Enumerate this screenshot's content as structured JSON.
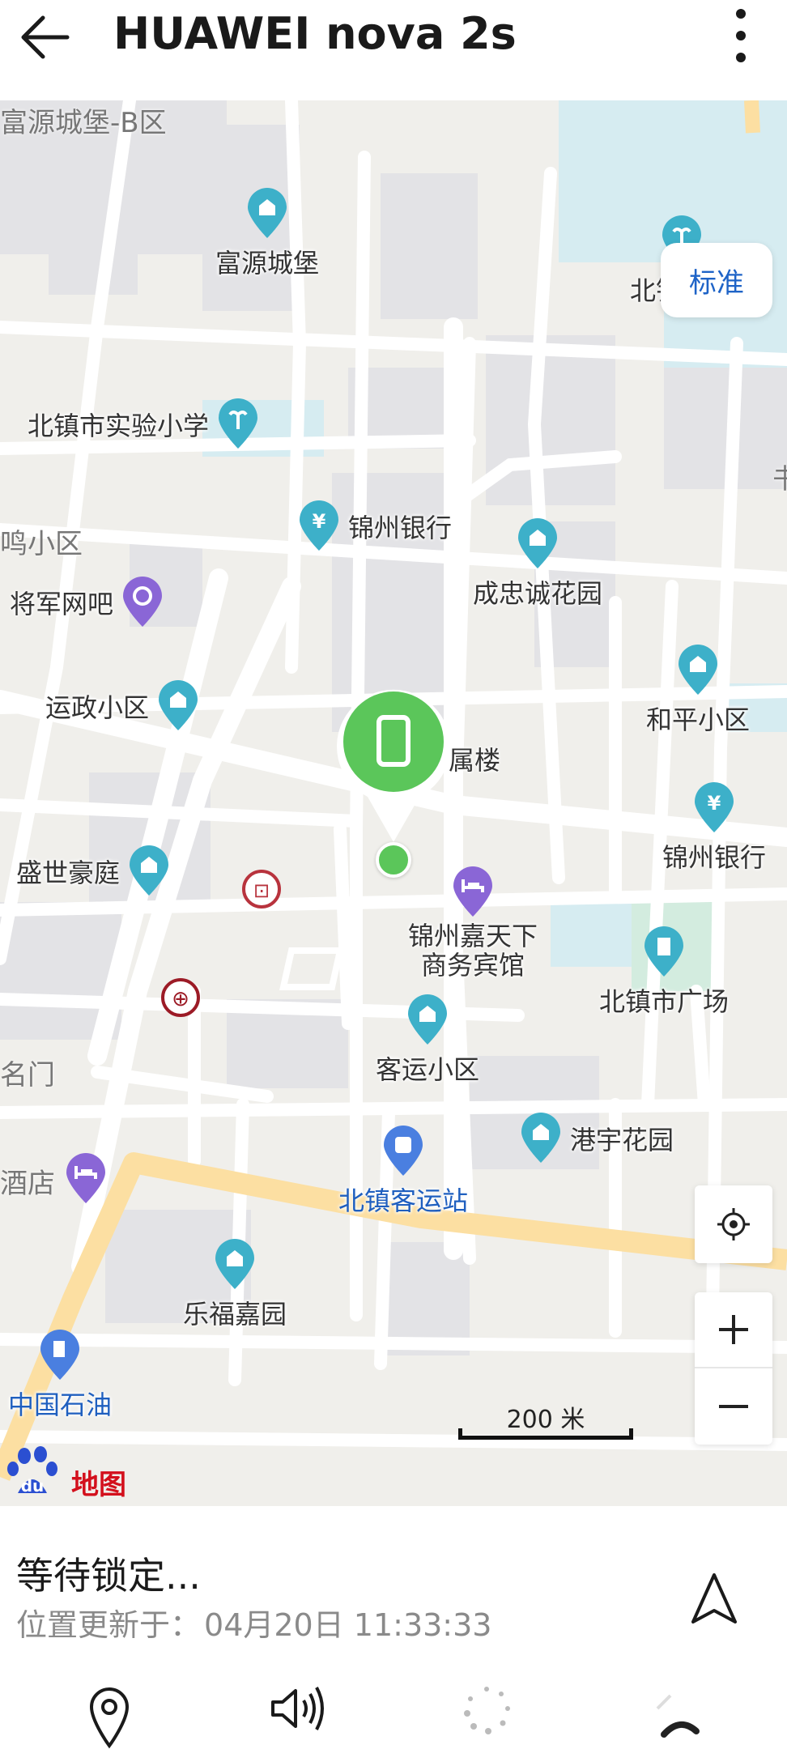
{
  "header": {
    "title": "HUAWEI nova 2s"
  },
  "map": {
    "layer_button": "标准",
    "area_labels": [
      "富源城堡-B区",
      "鸣小区",
      "名门",
      "酒店",
      "书"
    ],
    "pois": [
      {
        "name": "富源城堡",
        "icon": "residential-icon"
      },
      {
        "name": "北镇高中",
        "icon": "school-icon"
      },
      {
        "name": "北镇市实验小学",
        "icon": "school-icon"
      },
      {
        "name": "锦州银行",
        "icon": "bank-icon"
      },
      {
        "name": "成忠诚花园",
        "icon": "residential-icon"
      },
      {
        "name": "将军网吧",
        "icon": "internet-cafe-icon"
      },
      {
        "name": "运政小区",
        "icon": "residential-icon"
      },
      {
        "name": "和平小区",
        "icon": "residential-icon"
      },
      {
        "name": "属楼",
        "icon": "residential-icon"
      },
      {
        "name": "锦州银行",
        "icon": "bank-icon"
      },
      {
        "name": "盛世豪庭",
        "icon": "residential-icon"
      },
      {
        "name": "锦州嘉天下",
        "name2": "商务宾馆",
        "icon": "hotel-icon"
      },
      {
        "name": "北镇市广场",
        "icon": "building-icon"
      },
      {
        "name": "客运小区",
        "icon": "residential-icon"
      },
      {
        "name": "港宇花园",
        "icon": "residential-icon"
      },
      {
        "name": "北镇客运站",
        "icon": "bus-station-icon"
      },
      {
        "name": "乐福嘉园",
        "icon": "residential-icon"
      },
      {
        "name": "中国石油",
        "icon": "gas-station-icon"
      }
    ],
    "scale_label": "200 米",
    "brand": "地图",
    "brand_logo_text": "du"
  },
  "panel": {
    "status": "等待锁定...",
    "updated_label": "位置更新于：",
    "updated_time": "04月20日 11:33:33"
  },
  "colors": {
    "marker_green": "#5bc65a",
    "poi_teal": "#3db0c9",
    "poi_purple": "#8a66d6",
    "poi_blue": "#4a7fe0",
    "link_blue": "#1e63c7",
    "highway": "#fde2a6"
  }
}
